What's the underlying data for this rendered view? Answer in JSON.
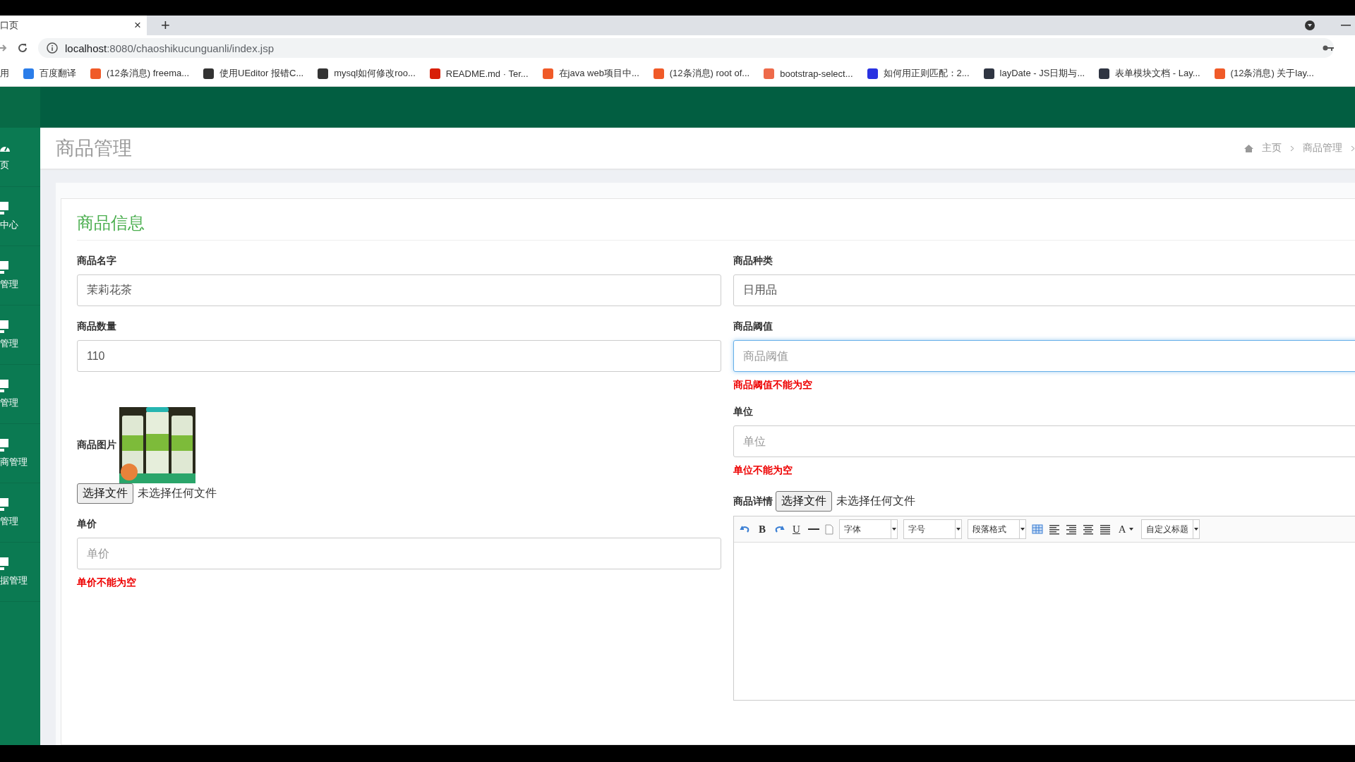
{
  "browser": {
    "tab_title": "口页",
    "tab_close": "×",
    "new_tab": "+",
    "url_host": "localhost",
    "url_rest": ":8080/chaoshikucunguanli/index.jsp",
    "bookmarks": [
      {
        "label": "用"
      },
      {
        "label": "百度翻译",
        "color": "#2b7de9"
      },
      {
        "label": "(12条消息) freema...",
        "color": "#f05a28"
      },
      {
        "label": "使用UEditor 报错C...",
        "color": "#333333"
      },
      {
        "label": "mysql如何修改roo...",
        "color": "#333333"
      },
      {
        "label": "README.md · Ter...",
        "color": "#d81e06"
      },
      {
        "label": "在java web项目中...",
        "color": "#f05a28"
      },
      {
        "label": "(12条消息) root of...",
        "color": "#f05a28"
      },
      {
        "label": "bootstrap-select...",
        "color": "#ee6a4a"
      },
      {
        "label": "如何用正则匹配：2...",
        "color": "#2932e1"
      },
      {
        "label": "layDate - JS日期与...",
        "color": "#2f3542"
      },
      {
        "label": "表单模块文档 - Lay...",
        "color": "#2f3542"
      },
      {
        "label": "(12条消息) 关于lay...",
        "color": "#f05a28"
      }
    ]
  },
  "sidebar": {
    "items": [
      {
        "label": "页",
        "kind": "dashboard"
      },
      {
        "label": "中心",
        "kind": "monitor"
      },
      {
        "label": "管理",
        "kind": "monitor"
      },
      {
        "label": "管理",
        "kind": "monitor"
      },
      {
        "label": "管理",
        "kind": "monitor"
      },
      {
        "label": "商管理",
        "kind": "monitor"
      },
      {
        "label": "管理",
        "kind": "monitor"
      },
      {
        "label": "据管理",
        "kind": "monitor"
      }
    ]
  },
  "page_header": {
    "title": "商品管理",
    "breadcrumb": [
      "主页",
      "商品管理"
    ]
  },
  "form": {
    "title": "商品信息",
    "left": [
      {
        "kind": "input",
        "label": "商品名字",
        "value": "茉莉花茶"
      },
      {
        "kind": "input",
        "label": "商品数量",
        "value": "110"
      },
      {
        "label": "商品图片",
        "file_button": "选择文件",
        "file_status": "未选择任何文件"
      },
      {
        "kind": "input",
        "label": "单价",
        "placeholder": "单价",
        "error": "单价不能为空"
      }
    ],
    "right": [
      {
        "kind": "input",
        "label": "商品种类",
        "value": "日用品"
      },
      {
        "kind": "input",
        "label": "商品阈值",
        "placeholder": "商品阈值",
        "error": "商品阈值不能为空",
        "focused": true
      },
      {
        "kind": "input",
        "label": "单位",
        "placeholder": "单位",
        "error": "单位不能为空"
      },
      {
        "kind": "editor",
        "label": "商品详情",
        "file_button": "选择文件",
        "file_status": "未选择任何文件",
        "toolbar": [
          {
            "kind": "undo"
          },
          {
            "kind": "bold",
            "label": "B"
          },
          {
            "kind": "redo"
          },
          {
            "kind": "underline",
            "label": "U"
          },
          {
            "kind": "rule"
          },
          {
            "kind": "page"
          },
          {
            "kind": "select",
            "label": "字体"
          },
          {
            "kind": "select",
            "label": "字号"
          },
          {
            "kind": "select",
            "label": "段落格式"
          },
          {
            "kind": "table"
          },
          {
            "kind": "align-left"
          },
          {
            "kind": "align-right"
          },
          {
            "kind": "align-center"
          },
          {
            "kind": "justify"
          },
          {
            "kind": "color",
            "label": "A"
          },
          {
            "kind": "select",
            "label": "自定义标题"
          }
        ]
      }
    ]
  }
}
